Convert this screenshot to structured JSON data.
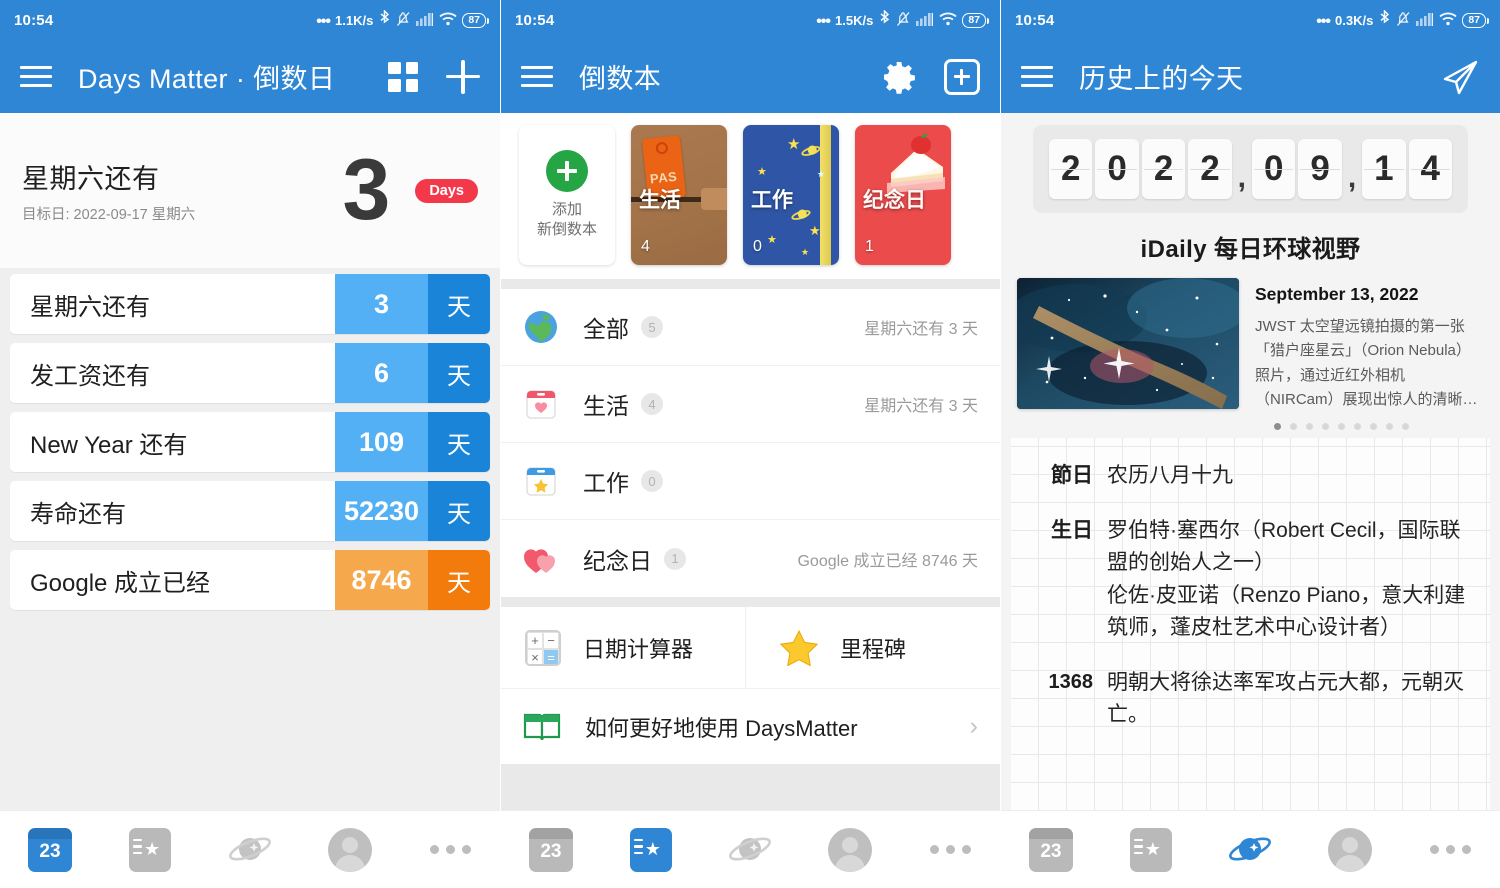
{
  "panels": [
    {
      "status": {
        "time": "10:54",
        "net_speed": "1.1K/s",
        "battery": "87"
      },
      "appbar": {
        "title": "Days Matter · 倒数日"
      },
      "hero": {
        "title": "星期六还有",
        "subtitle": "目标日: 2022-09-17 星期六",
        "number": "3",
        "badge": "Days"
      },
      "rows": [
        {
          "label": "星期六还有",
          "value": "3",
          "unit": "天",
          "color": "blue"
        },
        {
          "label": "发工资还有",
          "value": "6",
          "unit": "天",
          "color": "blue"
        },
        {
          "label": "New Year 还有",
          "value": "109",
          "unit": "天",
          "color": "blue"
        },
        {
          "label": "寿命还有",
          "value": "52230",
          "unit": "天",
          "color": "blue"
        },
        {
          "label": "Google 成立已经",
          "value": "8746",
          "unit": "天",
          "color": "orange"
        }
      ],
      "nav": {
        "active": "calendar"
      }
    },
    {
      "status": {
        "time": "10:54",
        "net_speed": "1.5K/s",
        "battery": "87"
      },
      "appbar": {
        "title": "倒数本"
      },
      "notebooks": [
        {
          "kind": "add",
          "line1": "添加",
          "line2": "新倒数本"
        },
        {
          "kind": "life",
          "name": "生活",
          "count": "4"
        },
        {
          "kind": "work",
          "name": "工作",
          "count": "0"
        },
        {
          "kind": "anniversary",
          "name": "纪念日",
          "count": "1"
        }
      ],
      "categories": [
        {
          "label": "全部",
          "badge": "5",
          "right": "星期六还有 3 天",
          "icon": "globe-icon"
        },
        {
          "label": "生活",
          "badge": "4",
          "right": "星期六还有 3 天",
          "icon": "calendar-heart-icon"
        },
        {
          "label": "工作",
          "badge": "0",
          "right": "",
          "icon": "calendar-star-icon"
        },
        {
          "label": "纪念日",
          "badge": "1",
          "right": "Google 成立已经 8746 天",
          "icon": "hearts-icon"
        }
      ],
      "tools": [
        {
          "label": "日期计算器",
          "icon": "calculator-icon"
        },
        {
          "label": "里程碑",
          "icon": "star-icon"
        }
      ],
      "help": {
        "label": "如何更好地使用 DaysMatter",
        "icon": "book-icon"
      },
      "nav": {
        "active": "notebook"
      }
    },
    {
      "status": {
        "time": "10:54",
        "net_speed": "0.3K/s",
        "battery": "87"
      },
      "appbar": {
        "title": "历史上的今天"
      },
      "flipdate": {
        "digits": [
          "2",
          "0",
          "2",
          "2",
          "0",
          "9",
          "1",
          "4"
        ],
        "separators": [
          ",",
          ","
        ]
      },
      "idaily_title": "iDaily 每日环球视野",
      "news": {
        "date": "September 13, 2022",
        "body": "JWST 太空望远镜拍摄的第一张「猎户座星云」（Orion Nebula）照片，通过近红外相机（NIRCam）展现出惊人的清晰…",
        "dots_total": 9,
        "dots_active": 1
      },
      "history": [
        {
          "key": "節日",
          "value": "农历八月十九"
        },
        {
          "key": "生日",
          "value": "罗伯特·塞西尔（Robert Cecil，国际联盟的创始人之一）\n伦佐·皮亚诺（Renzo Piano，意大利建筑师，蓬皮杜艺术中心设计者）"
        },
        {
          "key": "1368",
          "value": "明朝大将徐达率军攻占元大都，元朝灭亡。"
        }
      ],
      "nav": {
        "active": "planet"
      }
    }
  ],
  "colors": {
    "brand_blue": "#2f86d5",
    "row_blue_light": "#54b0f5",
    "row_blue_dark": "#1a84d8",
    "row_orange_light": "#f6a84d",
    "row_orange_dark": "#f37b0b",
    "badge_red": "#f3384a"
  }
}
